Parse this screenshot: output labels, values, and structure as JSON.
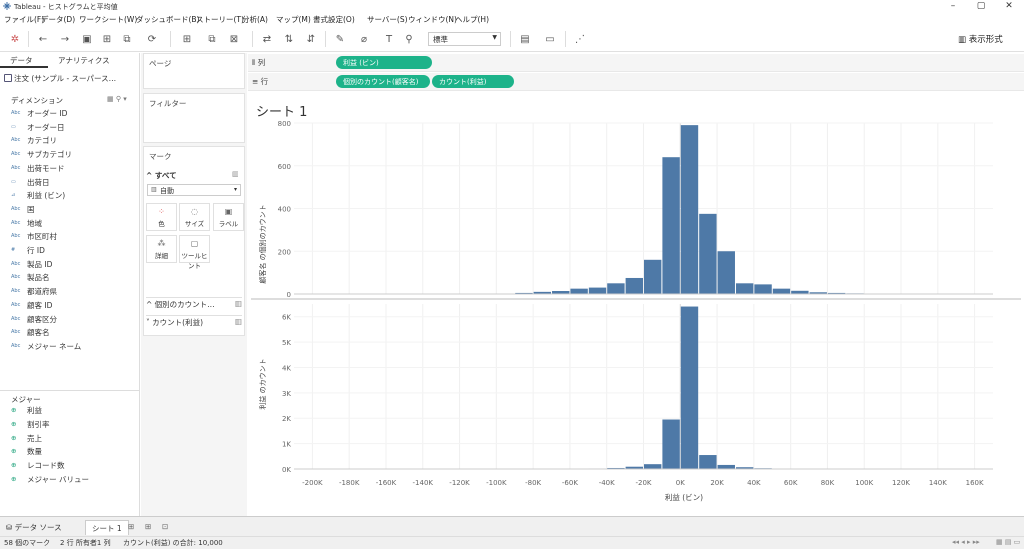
{
  "window": {
    "title": "Tableau - ヒストグラムと平均値"
  },
  "menu": [
    "ファイル(F)",
    "データ(D)",
    "ワークシート(W)",
    "ダッシュボード(B)",
    "ストーリー(T)",
    "分析(A)",
    "マップ(M)",
    "書式設定(O)",
    "サーバー(S)",
    "ウィンドウ(N)",
    "ヘルプ(H)"
  ],
  "toolbar": {
    "fit_select": "標準",
    "show_me": "表示形式"
  },
  "data_pane": {
    "tab_data": "データ",
    "tab_analytics": "アナリティクス",
    "datasource": "注文 (サンプル - スーパース…",
    "dimensions_header": "ディメンション",
    "dimensions": [
      {
        "icon": "Abc",
        "label": "オーダー ID"
      },
      {
        "icon": "▭",
        "label": "オーダー日"
      },
      {
        "icon": "Abc",
        "label": "カテゴリ"
      },
      {
        "icon": "Abc",
        "label": "サブカテゴリ"
      },
      {
        "icon": "Abc",
        "label": "出荷モード"
      },
      {
        "icon": "▭",
        "label": "出荷日"
      },
      {
        "icon": "⊿",
        "label": "利益 (ビン)"
      },
      {
        "icon": "Abc",
        "label": "国"
      },
      {
        "icon": "Abc",
        "label": "地域"
      },
      {
        "icon": "Abc",
        "label": "市区町村"
      },
      {
        "icon": "#",
        "label": "行 ID"
      },
      {
        "icon": "Abc",
        "label": "製品 ID"
      },
      {
        "icon": "Abc",
        "label": "製品名"
      },
      {
        "icon": "Abc",
        "label": "都道府県"
      },
      {
        "icon": "Abc",
        "label": "顧客 ID"
      },
      {
        "icon": "Abc",
        "label": "顧客区分"
      },
      {
        "icon": "Abc",
        "label": "顧客名"
      },
      {
        "icon": "Abc",
        "label": "メジャー ネーム"
      }
    ],
    "measures_header": "メジャー",
    "measures": [
      "利益",
      "割引率",
      "売上",
      "数量",
      "レコード数",
      "メジャー バリュー"
    ]
  },
  "cards": {
    "pages": "ページ",
    "filters": "フィルター",
    "marks": "マーク",
    "marks_all": "すべて",
    "mark_type": "自動",
    "buttons": [
      "色",
      "サイズ",
      "ラベル",
      "詳細",
      "ツールヒント"
    ],
    "sections": [
      "個別のカウント…",
      "カウント(利益)"
    ]
  },
  "shelves": {
    "columns_label": "列",
    "rows_label": "行",
    "columns_pills": [
      "利益 (ビン)"
    ],
    "rows_pills": [
      "個別のカウント(顧客名)",
      "カウント(利益)"
    ]
  },
  "sheet_title": "シート 1",
  "chart_data": [
    {
      "type": "bar",
      "ylabel": "顧客名 の個別のカウント",
      "xlabel": "利益 (ビン)",
      "ylim": [
        0,
        800
      ],
      "y_ticks": [
        "800",
        "600",
        "400",
        "200",
        "0"
      ],
      "x": [
        -100000,
        -90000,
        -80000,
        -70000,
        -60000,
        -50000,
        -40000,
        -30000,
        -20000,
        -10000,
        0,
        10000,
        20000,
        30000,
        40000,
        50000,
        60000,
        70000,
        80000,
        90000,
        100000,
        110000,
        120000,
        130000,
        140000,
        150000
      ],
      "values": [
        2,
        5,
        10,
        14,
        25,
        30,
        50,
        75,
        160,
        640,
        790,
        375,
        200,
        50,
        45,
        25,
        15,
        8,
        5,
        3,
        2,
        2,
        1,
        1,
        1,
        1
      ]
    },
    {
      "type": "bar",
      "ylabel": "利益 のカウント",
      "xlabel": "利益 (ビン)",
      "ylim": [
        0,
        6500
      ],
      "y_ticks": [
        "6K",
        "5K",
        "4K",
        "3K",
        "2K",
        "1K",
        "0K"
      ],
      "x_ticks": [
        "-200K",
        "-180K",
        "-160K",
        "-140K",
        "-120K",
        "-100K",
        "-80K",
        "-60K",
        "-40K",
        "-20K",
        "0K",
        "20K",
        "40K",
        "60K",
        "80K",
        "100K",
        "120K",
        "140K",
        "160K"
      ],
      "x": [
        -60000,
        -50000,
        -40000,
        -30000,
        -20000,
        -10000,
        0,
        10000,
        20000,
        30000,
        40000,
        50000
      ],
      "values": [
        10,
        20,
        40,
        90,
        190,
        1950,
        6400,
        550,
        160,
        70,
        30,
        10
      ]
    }
  ],
  "sheet_tabs": {
    "datasource": "データ ソース",
    "sheet1": "シート 1"
  },
  "status": {
    "marks": "58 個のマーク",
    "rows_cols": "2 行 所有者1 列",
    "sum": "カウント(利益) の合計: 10,000"
  }
}
